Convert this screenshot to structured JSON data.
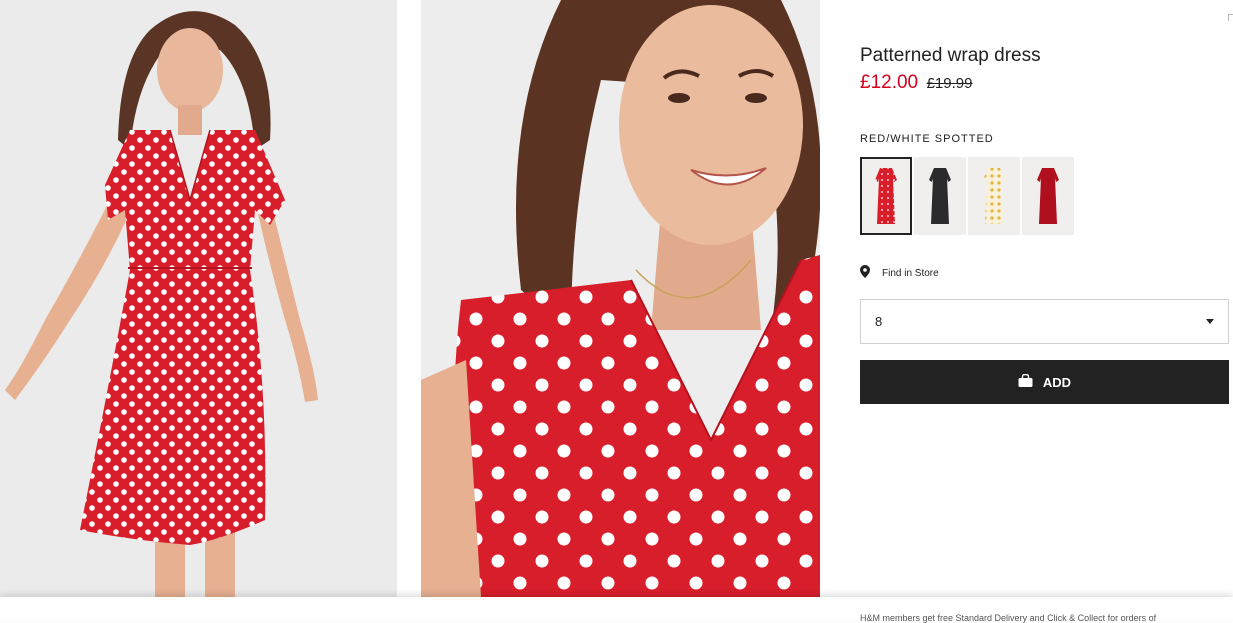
{
  "product": {
    "title": "Patterned wrap dress",
    "price_sale": "£12.00",
    "price_original": "£19.99",
    "color_name": "RED/WHITE SPOTTED",
    "swatches": [
      {
        "name": "red-white-spotted",
        "color": "#d81e2b",
        "selected": true
      },
      {
        "name": "black",
        "color": "#2b2b2e",
        "selected": false
      },
      {
        "name": "white-yellow-floral",
        "color": "#f3e6b5",
        "selected": false
      },
      {
        "name": "dark-red",
        "color": "#b0101e",
        "selected": false
      }
    ]
  },
  "store": {
    "label": "Find in Store",
    "icon": "location-pin-icon"
  },
  "size_select": {
    "value": "8"
  },
  "add_button": {
    "label": "ADD",
    "icon": "shopping-bag-icon"
  },
  "footer": {
    "text": "H&M members get free Standard Delivery and Click & Collect for orders of"
  },
  "colors": {
    "accent_red": "#d6001c",
    "button_black": "#222222"
  }
}
